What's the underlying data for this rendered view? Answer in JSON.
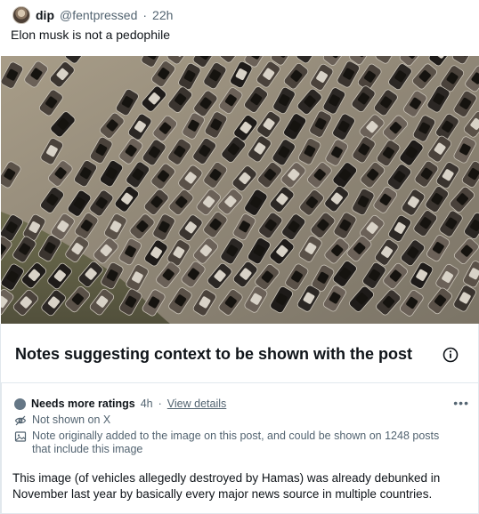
{
  "post": {
    "author_name": "dip",
    "author_handle": "@fentpressed",
    "separator": "·",
    "time": "22h",
    "text": "Elon musk is not a pedophile"
  },
  "image": {
    "icon": "aerial-photo-burned-cars"
  },
  "notes": {
    "title": "Notes suggesting context to be shown with the post",
    "info_icon": "info-circle-icon",
    "note": {
      "status": "Needs more ratings",
      "time": "4h",
      "separator": "·",
      "view_details": "View details",
      "more": "•••",
      "not_shown": "Not shown on X",
      "image_note": "Note originally added to the image on this post, and could be shown on 1248 posts that include this image",
      "body": "This image (of vehicles allegedly destroyed by Hamas) was already debunked in November last year by basically every major news source in multiple countries."
    }
  },
  "colors": {
    "text": "#0f1419",
    "muted": "#536471",
    "border": "#e1e8ed",
    "status_dot": "#657786"
  }
}
